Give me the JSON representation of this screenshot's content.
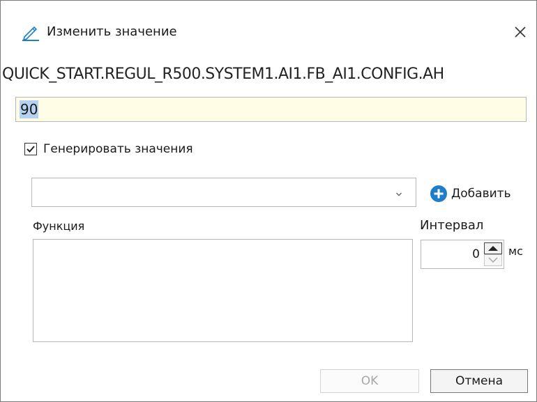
{
  "window": {
    "title": "Изменить значение",
    "title_icon": "pencil-icon",
    "close_icon": "close-icon"
  },
  "tag_path": "QUICK_START.REGUL_R500.SYSTEM1.AI1.FB_AI1.CONFIG.AH",
  "value_field": {
    "value": "90",
    "selected": true
  },
  "generate": {
    "checkbox_label": "Генерировать значения",
    "checked": true
  },
  "function_select": {
    "selected_value": "",
    "chevron_icon": "chevron-down-icon"
  },
  "add_button": {
    "label": "Добавить",
    "icon": "plus-circle-icon"
  },
  "function_label": "Функция",
  "interval": {
    "label": "Интервал",
    "value": "0",
    "unit": "мс"
  },
  "buttons": {
    "ok": "OK",
    "cancel": "Отмена"
  },
  "colors": {
    "value_field_bg": "#fffde6",
    "selection": "#b5d3f0",
    "accent": "#1e7fc8"
  }
}
